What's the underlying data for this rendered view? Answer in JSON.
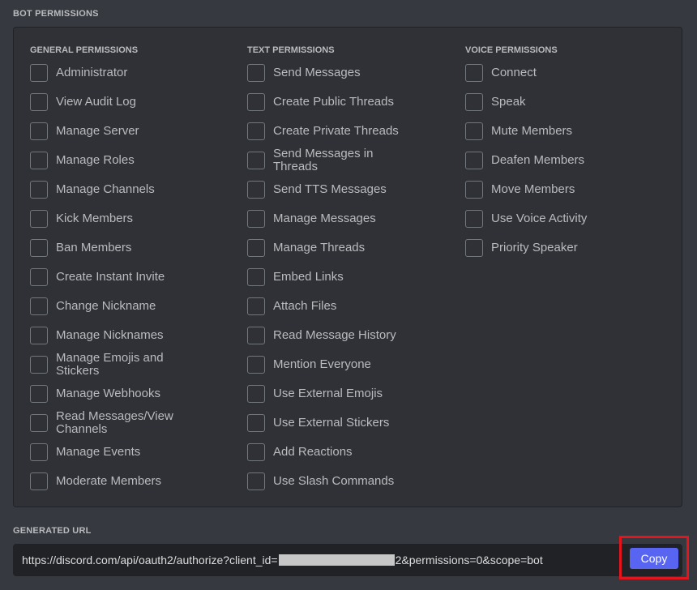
{
  "header": {
    "bot_permissions_title": "BOT PERMISSIONS",
    "generated_url_title": "GENERATED URL"
  },
  "permissions": {
    "general": {
      "title": "GENERAL PERMISSIONS",
      "items": [
        "Administrator",
        "View Audit Log",
        "Manage Server",
        "Manage Roles",
        "Manage Channels",
        "Kick Members",
        "Ban Members",
        "Create Instant Invite",
        "Change Nickname",
        "Manage Nicknames",
        "Manage Emojis and Stickers",
        "Manage Webhooks",
        "Read Messages/View Channels",
        "Manage Events",
        "Moderate Members"
      ]
    },
    "text": {
      "title": "TEXT PERMISSIONS",
      "items": [
        "Send Messages",
        "Create Public Threads",
        "Create Private Threads",
        "Send Messages in Threads",
        "Send TTS Messages",
        "Manage Messages",
        "Manage Threads",
        "Embed Links",
        "Attach Files",
        "Read Message History",
        "Mention Everyone",
        "Use External Emojis",
        "Use External Stickers",
        "Add Reactions",
        "Use Slash Commands"
      ]
    },
    "voice": {
      "title": "VOICE PERMISSIONS",
      "items": [
        "Connect",
        "Speak",
        "Mute Members",
        "Deafen Members",
        "Move Members",
        "Use Voice Activity",
        "Priority Speaker"
      ]
    }
  },
  "generated_url": {
    "prefix": "https://discord.com/api/oauth2/authorize?client_id=",
    "suffix": "2&permissions=0&scope=bot"
  },
  "copy_button": {
    "label": "Copy"
  },
  "colors": {
    "background": "#36393f",
    "panel": "#2f3136",
    "url_field": "#202225",
    "accent": "#5865f2",
    "highlight": "#e3141c"
  }
}
